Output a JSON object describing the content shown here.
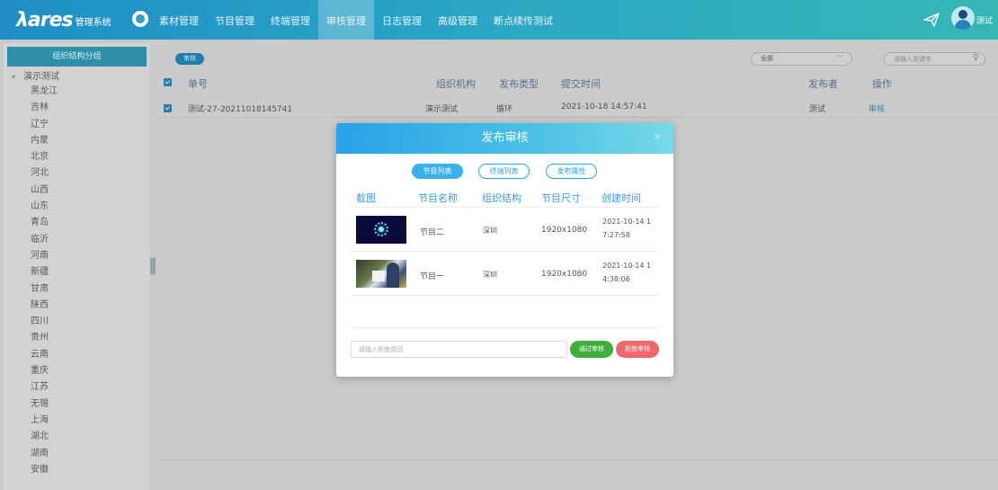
{
  "brand": {
    "logo": "λares",
    "system": "管理系统"
  },
  "nav": {
    "items": [
      "素材管理",
      "节目管理",
      "终端管理",
      "审核管理",
      "日志管理",
      "高级管理",
      "断点续传测试"
    ],
    "active_index": 3
  },
  "user": {
    "name": "测试"
  },
  "sidebar": {
    "header": "组织结构分组",
    "root": "演示测试",
    "items": [
      "黑龙江",
      "吉林",
      "辽宁",
      "内蒙",
      "北京",
      "河北",
      "山西",
      "山东",
      "青岛",
      "临沂",
      "河南",
      "新疆",
      "甘肃",
      "陕西",
      "四川",
      "贵州",
      "云南",
      "重庆",
      "江苏",
      "无锡",
      "上海",
      "湖北",
      "湖南",
      "安徽"
    ]
  },
  "toolbar": {
    "audit_label": "审核",
    "filter_value": "全部",
    "search_placeholder": "请输入关键字"
  },
  "table": {
    "headers": {
      "id": "单号",
      "org": "组织机构",
      "type": "发布类型",
      "time": "提交时间",
      "publisher": "发布者",
      "action": "操作"
    },
    "rows": [
      {
        "id": "测试-27-20211018145741",
        "org": "演示测试",
        "type": "循环",
        "time": "2021-10-18 14:57:41",
        "publisher": "测试",
        "action": "审核"
      }
    ]
  },
  "modal": {
    "title": "发布审核",
    "close": "×",
    "tabs": [
      "节目列表",
      "终端列表",
      "发布属性"
    ],
    "active_tab": 0,
    "headers": {
      "shot": "截图",
      "name": "节目名称",
      "org": "组织结构",
      "size": "节目尺寸",
      "created": "创建时间"
    },
    "rows": [
      {
        "name": "节目二",
        "org": "深圳",
        "size": "1920x1080",
        "created_line1": "2021-10-14 1",
        "created_line2": "7:27:58"
      },
      {
        "name": "节目一",
        "org": "深圳",
        "size": "1920x1080",
        "created_line1": "2021-10-14 1",
        "created_line2": "4:38:06"
      }
    ],
    "reason_placeholder": "请输入拒绝原因",
    "pass_label": "通过审核",
    "reject_label": "拒绝审核"
  }
}
